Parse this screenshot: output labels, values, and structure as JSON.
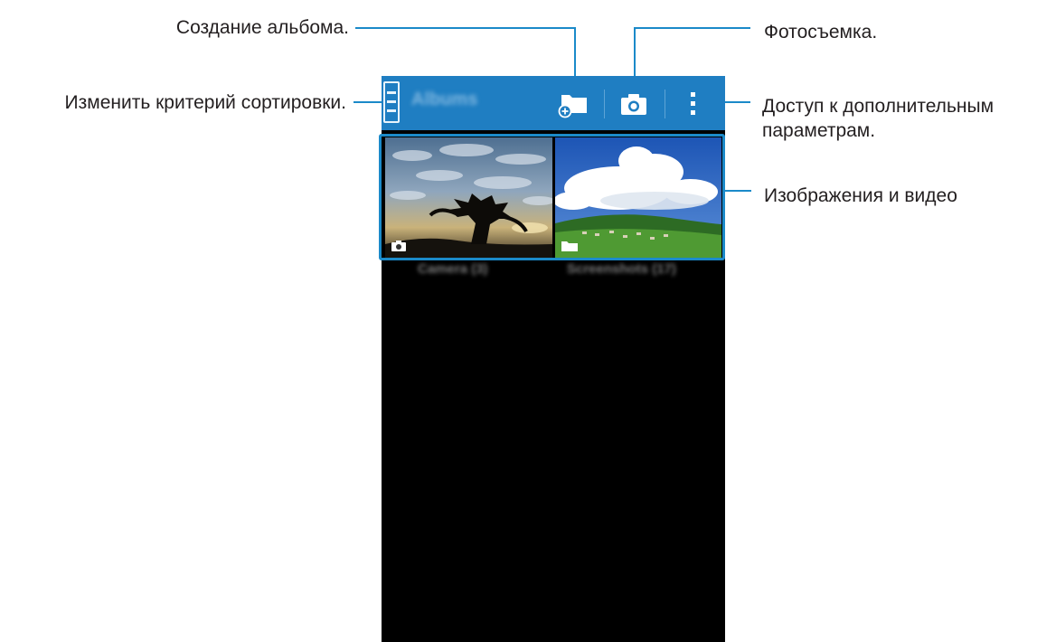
{
  "callouts": {
    "create_album": "Создание альбома.",
    "sort": "Изменить критерий сортировки.",
    "photo": "Фотосъемка.",
    "more_line1": "Доступ к дополнительным",
    "more_line2": "параметрам.",
    "media": "Изображения и видео"
  },
  "actionbar": {
    "title": "Albums"
  },
  "albums": [
    {
      "label": "Camera  (3)",
      "icon": "camera-icon"
    },
    {
      "label": "Screenshots  (17)",
      "icon": "folder-icon"
    }
  ],
  "colors": {
    "actionbar": "#1f7ec2",
    "leader_line": "#1b8ac9",
    "screen_background": "#000000"
  }
}
